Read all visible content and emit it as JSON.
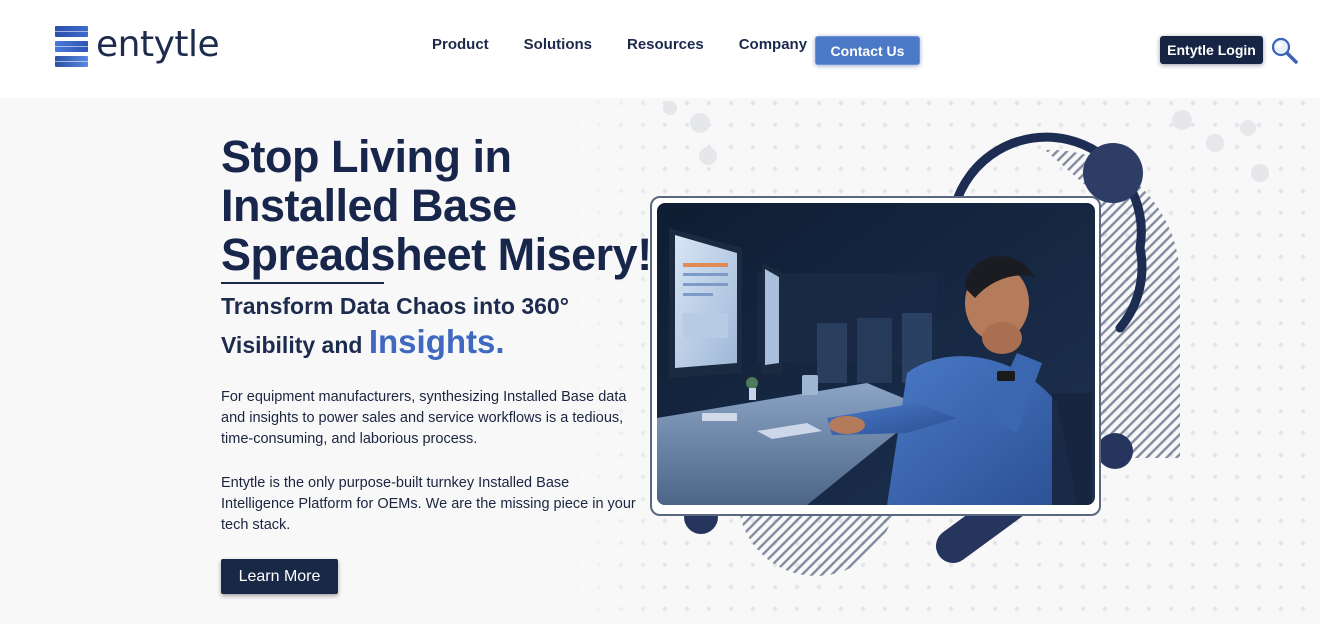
{
  "header": {
    "logo_text": "entytle",
    "nav": [
      "Product",
      "Solutions",
      "Resources",
      "Company"
    ],
    "contact_label": "Contact Us",
    "login_label": "Entytle Login",
    "search_icon": "search-icon"
  },
  "hero": {
    "headline_line1": "Stop Living in",
    "headline_line2": "Installed Base",
    "headline_line3": "Spreadsheet Misery!",
    "subhead_part1": "Transform Data Chaos into 360°",
    "subhead_part2": "Visibility and",
    "subhead_accent": "Insights.",
    "paragraph1": "For equipment manufacturers, synthesizing Installed Base data and insights to power sales and service workflows is a tedious, time-consuming, and laborious process.",
    "paragraph2": "Entytle is the only purpose-built turnkey Installed Base Intelligence Platform for OEMs. We are the missing piece in your tech stack.",
    "cta_label": "Learn More"
  },
  "colors": {
    "navy": "#17264a",
    "accent_blue": "#3f68c0",
    "contact_button": "#4b79c8",
    "login_button": "#172545",
    "hero_background": "#f8f8f9"
  }
}
